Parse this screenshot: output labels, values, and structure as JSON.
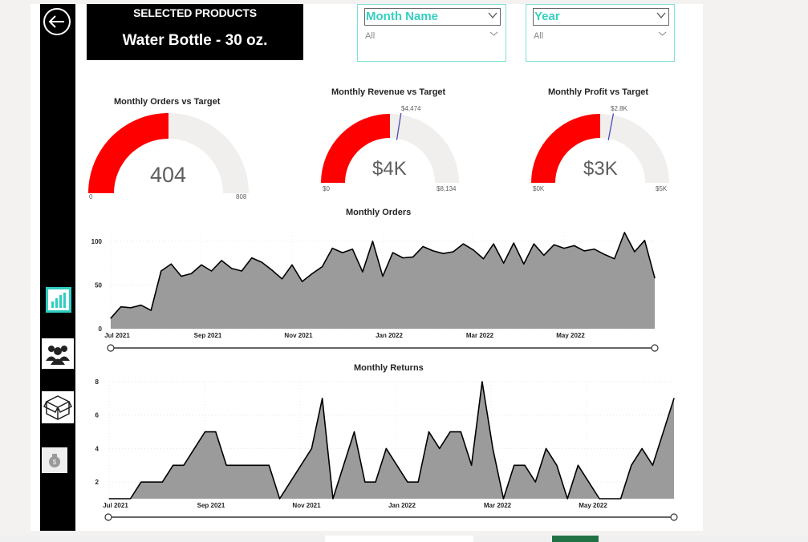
{
  "header": {
    "selected_title": "SELECTED PRODUCTS",
    "selected_value": "Water Bottle - 30 oz."
  },
  "slicers": {
    "month": {
      "label": "Month Name",
      "value": "All"
    },
    "year": {
      "label": "Year",
      "value": "All"
    }
  },
  "nav": {
    "icons": [
      "back-arrow-icon",
      "bar-chart-icon",
      "users-icon",
      "box-icon",
      "money-bag-icon"
    ]
  },
  "colors": {
    "accent_red": "#ff0000",
    "gauge_bg": "#f0efee",
    "teal": "#35d0c0",
    "area_fill": "#9b9b9b",
    "target_line": "#4a4ab0"
  },
  "gauges": {
    "orders": {
      "title": "Monthly Orders vs Target",
      "value_label": "404",
      "min_label": "0",
      "max_label": "808",
      "value": 404,
      "min": 0,
      "max": 808
    },
    "revenue": {
      "title": "Monthly Revenue vs Target",
      "value_label": "$4K",
      "min_label": "$0",
      "max_label": "$8,134",
      "target_label": "$4,474",
      "value": 4067,
      "target": 4474,
      "min": 0,
      "max": 8134
    },
    "profit": {
      "title": "Monthly Profit vs Target",
      "value_label": "$3K",
      "min_label": "$0K",
      "max_label": "$5K",
      "target_label": "$2.8K",
      "value": 2500,
      "target": 2800,
      "min": 0,
      "max": 5000
    }
  },
  "chart_data": [
    {
      "type": "area",
      "title": "Monthly Orders",
      "x_ticks": [
        "Jul 2021",
        "Sep 2021",
        "Nov 2021",
        "Jan 2022",
        "Mar 2022",
        "May 2022"
      ],
      "y_ticks": [
        "0",
        "50",
        "100"
      ],
      "ylim": [
        0,
        110
      ],
      "grid": true,
      "values": [
        12,
        25,
        24,
        27,
        21,
        66,
        74,
        60,
        63,
        73,
        66,
        78,
        69,
        66,
        81,
        76,
        67,
        57,
        73,
        54,
        63,
        71,
        92,
        87,
        91,
        65,
        100,
        60,
        87,
        81,
        82,
        94,
        89,
        86,
        88,
        97,
        90,
        80,
        97,
        75,
        98,
        74,
        97,
        84,
        96,
        92,
        95,
        89,
        91,
        85,
        80,
        110,
        88,
        101,
        58
      ]
    },
    {
      "type": "area",
      "title": "Monthly Returns",
      "x_ticks": [
        "Jul 2021",
        "Sep 2021",
        "Nov 2021",
        "Jan 2022",
        "Mar 2022",
        "May 2022"
      ],
      "y_ticks": [
        "2",
        "4",
        "6",
        "8"
      ],
      "ylim": [
        1,
        8
      ],
      "grid": true,
      "values": [
        1,
        1,
        1,
        2,
        2,
        2,
        3,
        3,
        4,
        5,
        5,
        3,
        3,
        3,
        3,
        3,
        1,
        2,
        3,
        4,
        7,
        1,
        3,
        5,
        2,
        2,
        4,
        3,
        2,
        2,
        5,
        4,
        5,
        5,
        3,
        8,
        4,
        1,
        3,
        3,
        2,
        4,
        3,
        1,
        3,
        2,
        1,
        1,
        1,
        3,
        4,
        3,
        5,
        7
      ]
    }
  ]
}
